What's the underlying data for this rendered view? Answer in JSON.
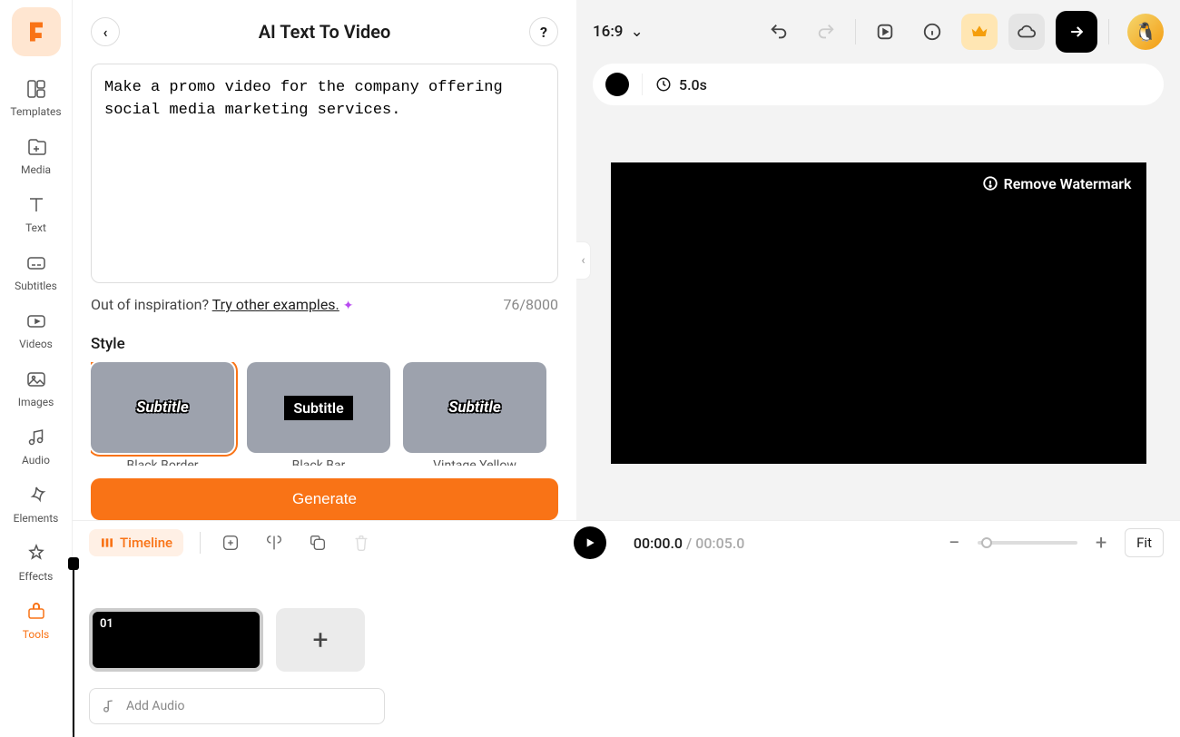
{
  "sidebar": {
    "items": [
      {
        "label": "Templates"
      },
      {
        "label": "Media"
      },
      {
        "label": "Text"
      },
      {
        "label": "Subtitles"
      },
      {
        "label": "Videos"
      },
      {
        "label": "Images"
      },
      {
        "label": "Audio"
      },
      {
        "label": "Elements"
      },
      {
        "label": "Effects"
      },
      {
        "label": "Tools"
      }
    ]
  },
  "panel": {
    "title": "AI Text To Video",
    "prompt": "Make a promo video for the company offering social media marketing services.",
    "inspiration_prefix": "Out of inspiration? ",
    "inspiration_link": "Try other examples.",
    "char_count": "76/8000",
    "style_label": "Style",
    "styles": [
      {
        "subtitle": "Subtitle",
        "name": "Black Border"
      },
      {
        "subtitle": "Subtitle",
        "name": "Black Bar"
      },
      {
        "subtitle": "Subtitle",
        "name": "Vintage Yellow"
      }
    ],
    "generate": "Generate"
  },
  "toolbar": {
    "aspect": "16:9"
  },
  "scene": {
    "duration": "5.0s"
  },
  "canvas": {
    "watermark": "Remove Watermark"
  },
  "timeline": {
    "label": "Timeline",
    "current": "00:00.0",
    "total": "00:05.0",
    "fit": "Fit",
    "clip_num": "01",
    "add_audio": "Add Audio"
  }
}
